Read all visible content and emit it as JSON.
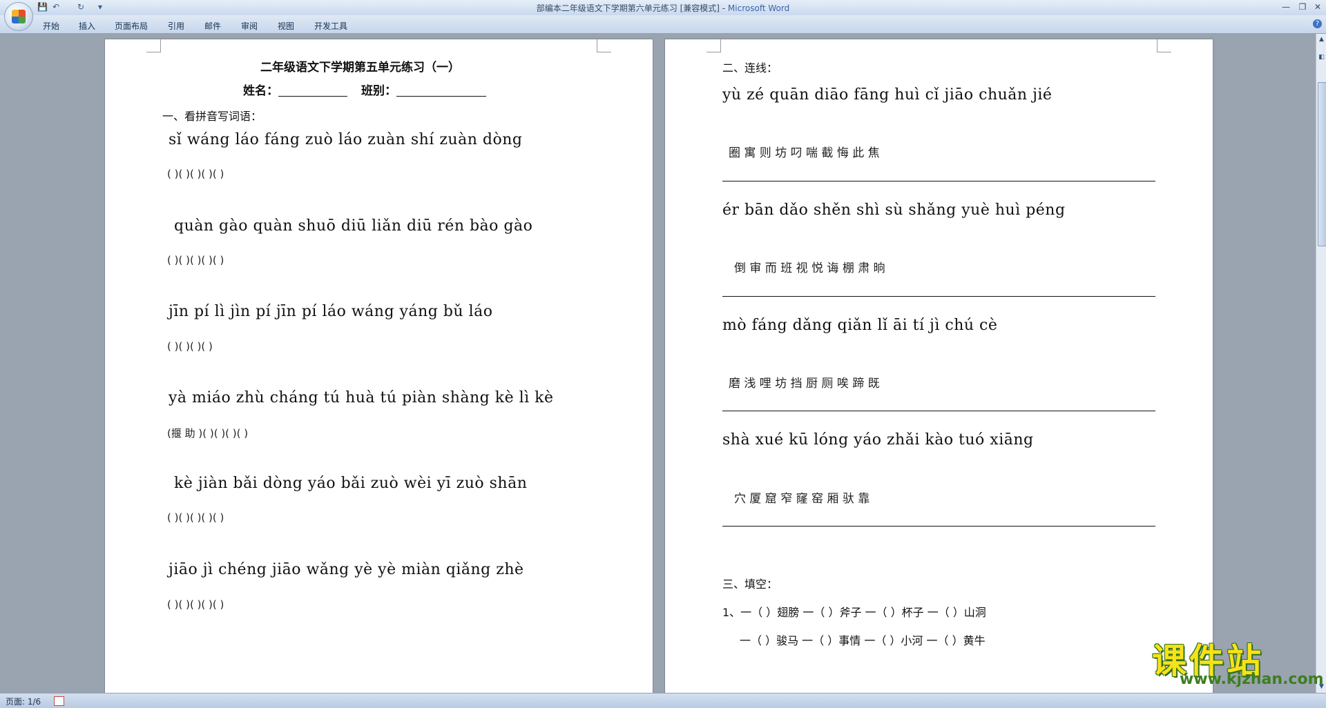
{
  "window": {
    "title": "部编本二年级语文下学期第六单元练习 [兼容模式] - ",
    "app_name": "Microsoft Word"
  },
  "quick_access": {
    "save": "💾",
    "undo": "↶",
    "redo": "↻",
    "customize": "▾"
  },
  "window_buttons": {
    "minimize": "—",
    "restore": "❐",
    "close": "✕"
  },
  "ribbon": {
    "tabs": [
      "开始",
      "插入",
      "页面布局",
      "引用",
      "邮件",
      "审阅",
      "视图",
      "开发工具"
    ],
    "help": "?"
  },
  "page1": {
    "title": "二年级语文下学期第五单元练习（一）",
    "name_label": "姓名：",
    "class_label": "班别：",
    "section1": "一、看拼音写词语：",
    "rows": [
      {
        "pinyin": "sǐ wáng  láo fáng  zuò láo  zuàn shí  zuàn dòng",
        "blank": "(         )(           )(          )(           )(            )"
      },
      {
        "pinyin": "quàn gào  quàn shuō  diū liǎn  diū rén  bào gào",
        "blank": "(             )(              )(             )(           )(            )"
      },
      {
        "pinyin": "jīn pí lì jìn  pí jīn  pí láo  wáng yáng bǔ láo",
        "blank": "(                       )(         )(         )(                           )"
      },
      {
        "pinyin": "yà miáo zhù cháng  tú huà  tú piàn  shàng kè  lì kè",
        "blank": "(揠          助         )(          )(         )(             )(        )"
      },
      {
        "pinyin": "kè jiàn  bǎi dòng  yáo bǎi  zuò wèi  yī zuò shān",
        "blank": "(           )(            )(           )(           )(                 )"
      },
      {
        "pinyin": "jiāo jì  chéng jiāo  wǎng yè  yè miàn  qiǎng zhè",
        "blank": "(          )(                )(           )(          )(                )"
      }
    ]
  },
  "page2": {
    "section2": "二、连线：",
    "groups": [
      {
        "pinyin": "yù  zé  quān  diāo  fāng  huì  cǐ  jiāo  chuǎn  jié",
        "hanzi": "圈    寓    则     坊     叼     喘     截    悔    此     焦"
      },
      {
        "pinyin": "ér  bān  dǎo  shěn  shì  sù  shǎng  yuè  huì  péng",
        "hanzi": "倒    审    而    班    视    悦    诲     棚     肃     晌"
      },
      {
        "pinyin": "mò  fáng  dǎng  qiǎn  lǐ  āi  tí  jì  chú  cè",
        "hanzi": "磨    浅    哩    坊    挡    厨    厕    唉    蹄    既"
      },
      {
        "pinyin": "shà  xué  kū  lóng  yáo  zhǎi  kào  tuó  xiāng",
        "hanzi": "穴     厦      窟     窄     窿     窑     厢     驮     靠"
      }
    ],
    "section3": "三、填空：",
    "fill_row1": "1、一（    ）翅膀    一（    ）斧子    一（    ）杯子    一（    ）山洞",
    "fill_row2": "一（    ）骏马    一（    ）事情    一（    ）小河    一（    ）黄牛"
  },
  "status": {
    "page": "页面: 1/6"
  },
  "watermark": {
    "main": "课件站",
    "url": "www.kjzhan.com"
  }
}
